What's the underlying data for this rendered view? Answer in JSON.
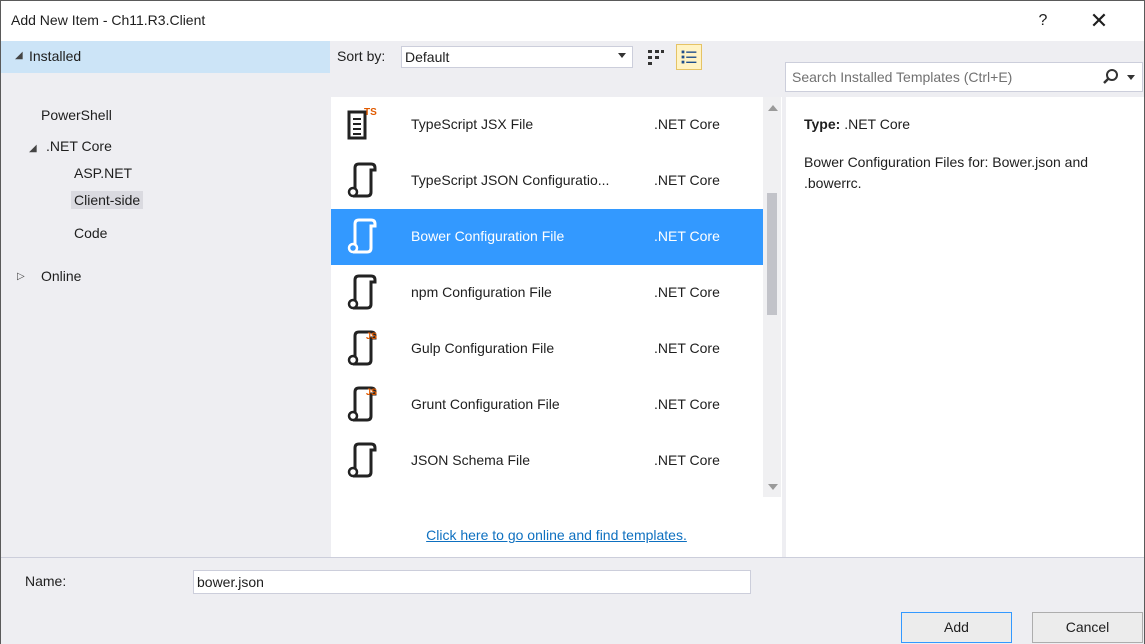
{
  "window": {
    "title": "Add New Item - Ch11.R3.Client",
    "help_label": "?",
    "close_label": "✕"
  },
  "left_panel": {
    "installed_label": "Installed",
    "tree": {
      "powershell": "PowerShell",
      "net_core": ".NET Core",
      "aspnet": "ASP.NET",
      "client_side": "Client-side",
      "code": "Code",
      "online": "Online"
    },
    "selected_item": "Client-side"
  },
  "sort": {
    "label": "Sort by:",
    "value": "Default"
  },
  "search": {
    "placeholder": "Search Installed Templates (Ctrl+E)"
  },
  "templates": [
    {
      "name": "TypeScript JSX File",
      "category": ".NET Core",
      "icon": "typescript-jsx-file-icon",
      "selected": false
    },
    {
      "name": "TypeScript JSON Configuratio...",
      "category": ".NET Core",
      "icon": "json-config-icon",
      "selected": false
    },
    {
      "name": "Bower Configuration File",
      "category": ".NET Core",
      "icon": "bower-config-icon",
      "selected": true
    },
    {
      "name": "npm Configuration File",
      "category": ".NET Core",
      "icon": "npm-config-icon",
      "selected": false
    },
    {
      "name": "Gulp Configuration File",
      "category": ".NET Core",
      "icon": "gulp-js-config-icon",
      "selected": false
    },
    {
      "name": "Grunt Configuration File",
      "category": ".NET Core",
      "icon": "grunt-js-config-icon",
      "selected": false
    },
    {
      "name": "JSON Schema File",
      "category": ".NET Core",
      "icon": "json-schema-icon",
      "selected": false
    }
  ],
  "online_link": "Click here to go online and find templates.",
  "details": {
    "type_label": "Type:",
    "type_value": ".NET Core",
    "description": "Bower Configuration Files for: Bower.json and .bowerrc."
  },
  "footer": {
    "name_label": "Name:",
    "name_value": "bower.json",
    "add_label": "Add",
    "cancel_label": "Cancel"
  },
  "colors": {
    "selection": "#3399ff",
    "installed_header": "#cce4f7",
    "link": "#0e70c0",
    "dialog_bg": "#eeeef2"
  }
}
